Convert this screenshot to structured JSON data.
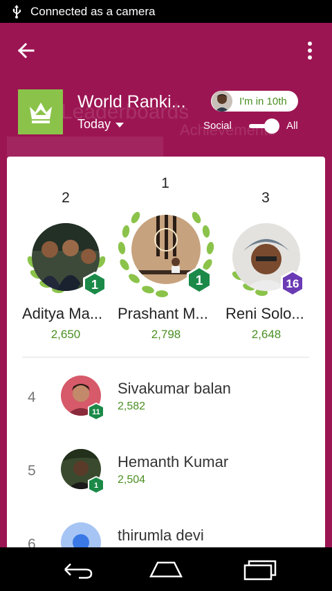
{
  "status_bar": {
    "text": "Connected as a camera",
    "icon": "usb-icon"
  },
  "app_bar": {
    "back_icon": "arrow-left-icon",
    "menu_icon": "more-vert-icon"
  },
  "header": {
    "title": "World Ranki...",
    "ghost_text_1": "Leaderboards",
    "ghost_text_2": "Achievements",
    "time_filter": "Today",
    "my_rank": "I'm in 10th",
    "toggle_left": "Social",
    "toggle_right": "All",
    "crown_icon": "crown-icon",
    "colors": {
      "brand": "#9c1553",
      "tile": "#8bc34a",
      "score": "#4a8f22"
    }
  },
  "podium": [
    {
      "rank": "2",
      "name": "Aditya Ma...",
      "score": "2,650",
      "level": "1",
      "badge_color": "#1b8a48"
    },
    {
      "rank": "1",
      "name": "Prashant M...",
      "score": "2,798",
      "level": "1",
      "badge_color": "#1b8a48"
    },
    {
      "rank": "3",
      "name": "Reni Solo...",
      "score": "2,648",
      "level": "16",
      "badge_color": "#6a3bb5"
    }
  ],
  "list": [
    {
      "rank": "4",
      "name": "Sivakumar balan",
      "score": "2,582",
      "level": "11"
    },
    {
      "rank": "5",
      "name": "Hemanth Kumar",
      "score": "2,504",
      "level": "1"
    },
    {
      "rank": "6",
      "name": "thirumla devi",
      "score": "",
      "level": ""
    }
  ],
  "nav_bar": {
    "back": "nav-back-icon",
    "home": "nav-home-icon",
    "recents": "nav-recents-icon"
  }
}
